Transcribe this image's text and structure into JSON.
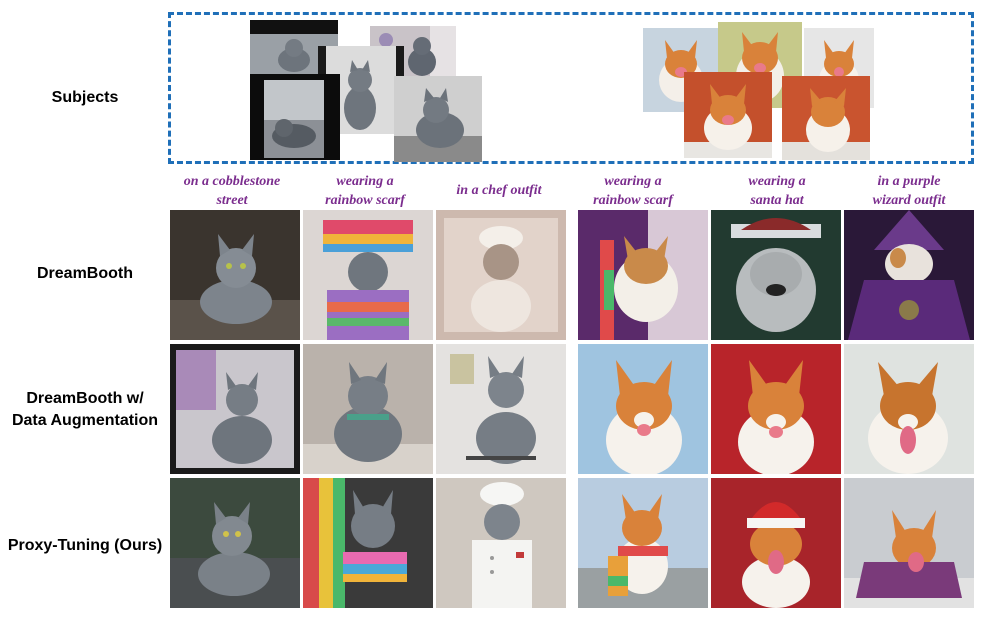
{
  "row_labels": {
    "subjects": "Subjects",
    "dreambooth": "DreamBooth",
    "dreambooth_aug_line1": "DreamBooth w/",
    "dreambooth_aug_line2": "Data Augmentation",
    "proxy_tuning": "Proxy-Tuning (Ours)"
  },
  "prompts": [
    {
      "line1": "on a cobblestone",
      "line2": "street"
    },
    {
      "line1": "wearing a",
      "line2": "rainbow scarf"
    },
    {
      "line1": "in a chef outfit",
      "line2": ""
    },
    {
      "line1": "wearing a",
      "line2": "rainbow scarf"
    },
    {
      "line1": "wearing a",
      "line2": "santa hat"
    },
    {
      "line1": "in a purple",
      "line2": "wizard outfit"
    }
  ],
  "colors": {
    "prompt_text": "#7b2d8e",
    "box_border": "#1f6fb8",
    "cat_gray": "#7d848c",
    "corgi_orange": "#d9823a"
  }
}
